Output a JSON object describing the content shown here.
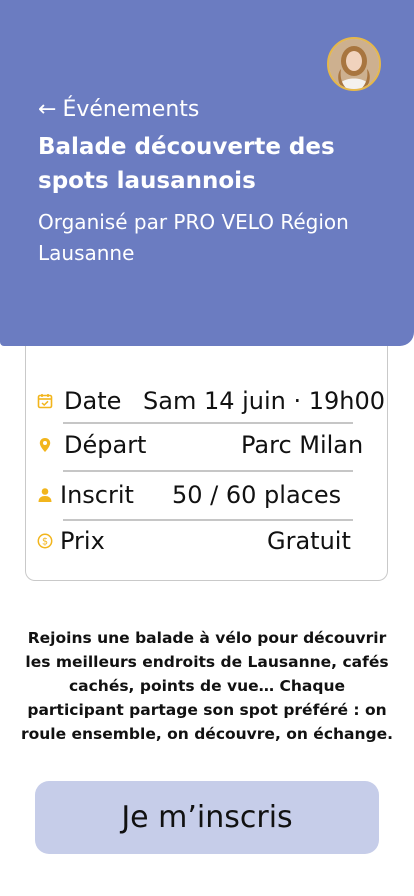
{
  "header": {
    "back_label": "Événements",
    "title": "Balade découverte des spots lausannois",
    "organizer": "Organisé par PRO VELO Région Lausanne",
    "avatar_icon": "user-avatar-photo",
    "background_color": "#6b7cc1"
  },
  "details": {
    "date": {
      "icon": "calendar-icon",
      "label": "Date",
      "value": "Sam 14 juin · 19h00"
    },
    "start": {
      "icon": "location-pin-icon",
      "label": "Départ",
      "value": "Parc Milan"
    },
    "registered": {
      "icon": "person-icon",
      "label": "Inscrit",
      "value": "50 / 60 places"
    },
    "price": {
      "icon": "coin-icon",
      "label": "Prix",
      "value": "Gratuit"
    },
    "icon_color": "#f2b51c"
  },
  "description": "Rejoins une balade à vélo pour découvrir les meilleurs endroits de Lausanne, cafés cachés, points de vue… Chaque participant partage son spot préféré : on roule ensemble, on découvre, on échange.",
  "cta": {
    "label": "Je m’inscris",
    "color": "#c6cde9"
  }
}
